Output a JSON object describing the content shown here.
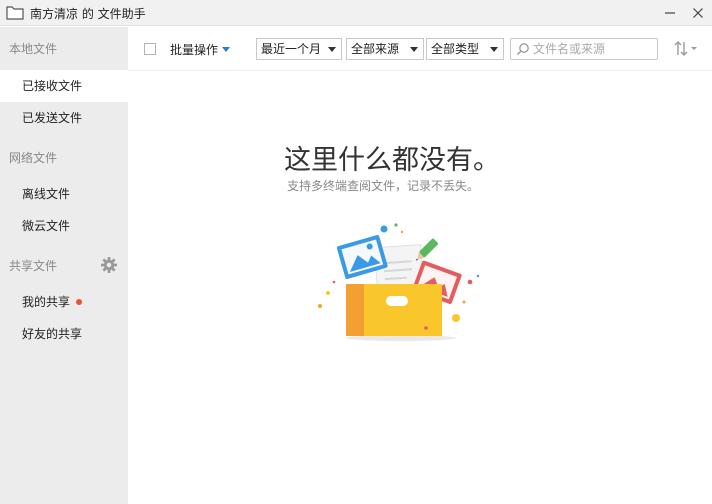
{
  "window": {
    "title": "南方清凉 的 文件助手"
  },
  "sidebar": {
    "sections": [
      {
        "label": "本地文件"
      },
      {
        "label": "网络文件"
      },
      {
        "label": "共享文件"
      }
    ],
    "items": [
      {
        "label": "已接收文件",
        "active": true
      },
      {
        "label": "已发送文件"
      },
      {
        "label": "离线文件"
      },
      {
        "label": "微云文件"
      },
      {
        "label": "我的共享",
        "badge": "red-dot"
      },
      {
        "label": "好友的共享"
      }
    ]
  },
  "toolbar": {
    "batch_label": "批量操作",
    "filters": [
      {
        "selected": "最近一个月"
      },
      {
        "selected": "全部来源"
      },
      {
        "selected": "全部类型"
      }
    ],
    "search_placeholder": "文件名或来源"
  },
  "empty": {
    "title": "这里什么都没有。",
    "subtitle": "支持多终端查阅文件，记录不丢失。"
  },
  "colors": {
    "accent": "#2a7ad3",
    "badge": "#e8542f",
    "sidebar_bg": "#ececec"
  }
}
